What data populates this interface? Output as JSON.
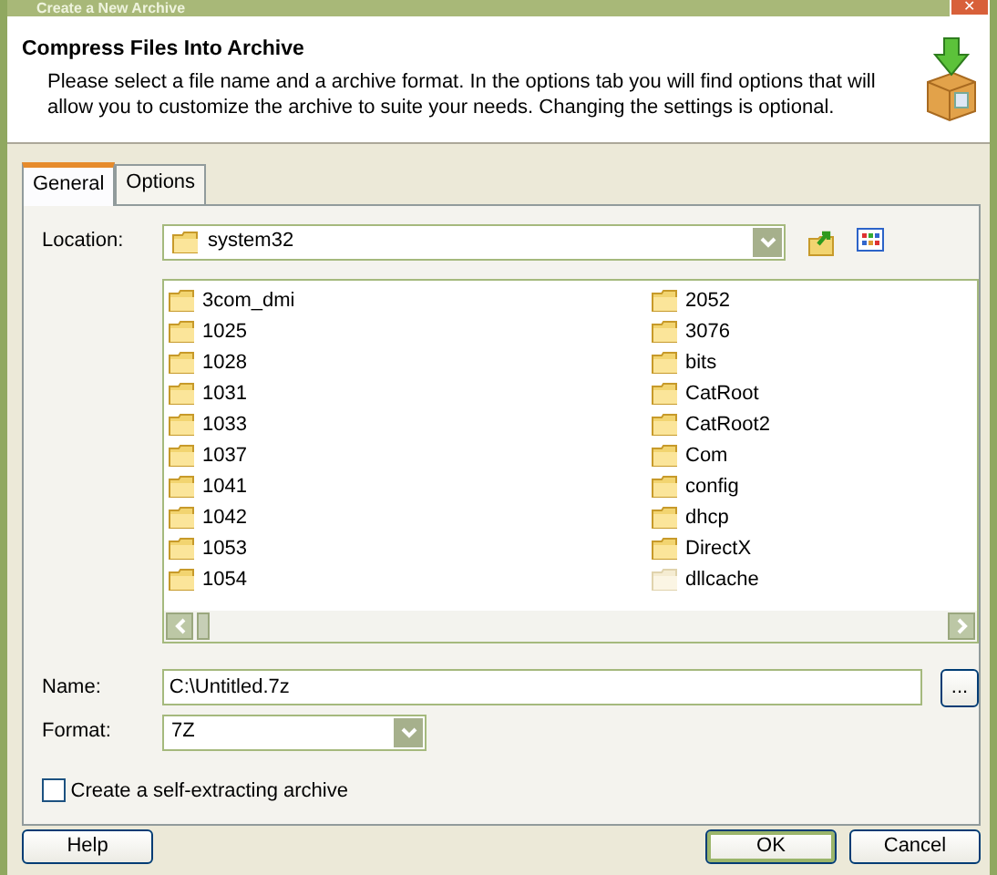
{
  "window": {
    "title": "Create a New Archive",
    "close_label": "✕"
  },
  "header": {
    "title": "Compress Files Into Archive",
    "description": "Please select a file name and a archive format. In the options tab you will find options that will allow you to customize the archive to suite your needs. Changing the settings is optional."
  },
  "tabs": [
    {
      "label": "General",
      "selected": true
    },
    {
      "label": "Options",
      "selected": false
    }
  ],
  "location": {
    "label": "Location:",
    "value": "system32"
  },
  "folders": [
    {
      "name": "3com_dmi",
      "hidden": false
    },
    {
      "name": "1025",
      "hidden": false
    },
    {
      "name": "1028",
      "hidden": false
    },
    {
      "name": "1031",
      "hidden": false
    },
    {
      "name": "1033",
      "hidden": false
    },
    {
      "name": "1037",
      "hidden": false
    },
    {
      "name": "1041",
      "hidden": false
    },
    {
      "name": "1042",
      "hidden": false
    },
    {
      "name": "1053",
      "hidden": false
    },
    {
      "name": "1054",
      "hidden": false
    },
    {
      "name": "2052",
      "hidden": false
    },
    {
      "name": "3076",
      "hidden": false
    },
    {
      "name": "bits",
      "hidden": false
    },
    {
      "name": "CatRoot",
      "hidden": false
    },
    {
      "name": "CatRoot2",
      "hidden": false
    },
    {
      "name": "Com",
      "hidden": false
    },
    {
      "name": "config",
      "hidden": false
    },
    {
      "name": "dhcp",
      "hidden": false
    },
    {
      "name": "DirectX",
      "hidden": false
    },
    {
      "name": "dllcache",
      "hidden": true
    }
  ],
  "name_field": {
    "label": "Name:",
    "value": "C:\\Untitled.7z",
    "browse_label": "..."
  },
  "format": {
    "label": "Format:",
    "value": "7Z"
  },
  "sfx": {
    "label": "Create a self-extracting archive",
    "checked": false
  },
  "buttons": [
    {
      "label": "Help",
      "kind": "help"
    },
    {
      "label": "OK",
      "kind": "default"
    },
    {
      "label": "Cancel",
      "kind": "normal"
    }
  ]
}
